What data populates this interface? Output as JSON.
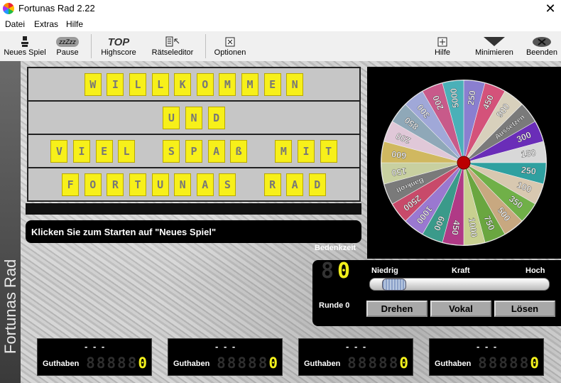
{
  "window": {
    "title": "Fortunas Rad 2.22",
    "close_icon": "close-icon"
  },
  "menu": [
    "Datei",
    "Extras",
    "Hilfe"
  ],
  "toolbar": {
    "neues_spiel": "Neues Spiel",
    "pause": "Pause",
    "pause_glyph": "zzZzz",
    "highscore": "Highscore",
    "highscore_glyph": "TOP",
    "raetseleditor": "Rätseleditor",
    "optionen": "Optionen",
    "hilfe": "Hilfe",
    "minimieren": "Minimieren",
    "beenden": "Beenden"
  },
  "side_banner": "Fortunas Rad",
  "board": {
    "rows": [
      "WILLKOMMEN",
      "UND",
      "VIEL SPAß MIT",
      "FORTUNAS RAD"
    ]
  },
  "message": "Klicken Sie zum Starten auf \"Neues Spiel\"",
  "wheel": {
    "segments": [
      {
        "label": "250",
        "color": "#8a7fd0"
      },
      {
        "label": "450",
        "color": "#d4527a"
      },
      {
        "label": "900",
        "color": "#d8d0bc"
      },
      {
        "label": "Aussetzen",
        "color": "#7a7a7a"
      },
      {
        "label": "300",
        "color": "#6a2db8"
      },
      {
        "label": "150",
        "color": "#d8d8d8"
      },
      {
        "label": "250",
        "color": "#2fa0a0"
      },
      {
        "label": "100",
        "color": "#d8c8b0"
      },
      {
        "label": "350",
        "color": "#70b048"
      },
      {
        "label": "500",
        "color": "#c8a880"
      },
      {
        "label": "750",
        "color": "#6aa640"
      },
      {
        "label": "1000",
        "color": "#c8d090"
      },
      {
        "label": "450",
        "color": "#b03a86"
      },
      {
        "label": "600",
        "color": "#3a9a8a"
      },
      {
        "label": "1000",
        "color": "#9a78d0"
      },
      {
        "label": "2500",
        "color": "#c84a6a"
      },
      {
        "label": "Bankrott",
        "color": "#7a7a7a"
      },
      {
        "label": "150",
        "color": "#c8d0a0"
      },
      {
        "label": "600",
        "color": "#d0b860"
      },
      {
        "label": "200",
        "color": "#e0c8d8"
      },
      {
        "label": "850",
        "color": "#8fa8b8"
      },
      {
        "label": "300",
        "color": "#a0a8d8"
      },
      {
        "label": "200",
        "color": "#c85a8a"
      },
      {
        "label": "5000",
        "color": "#4ab0b8"
      }
    ]
  },
  "controls": {
    "bedenkzeit_label": "Bedenkzeit",
    "timer_value": "0",
    "kraft_min": "Niedrig",
    "kraft_label": "Kraft",
    "kraft_max": "Hoch",
    "kraft_level": 0.08,
    "runde_label": "Runde 0",
    "drehen": "Drehen",
    "vokal": "Vokal",
    "loesen": "Lösen"
  },
  "players": [
    {
      "name": "- - -",
      "label": "Guthaben",
      "value": "0"
    },
    {
      "name": "- - -",
      "label": "Guthaben",
      "value": "0"
    },
    {
      "name": "- - -",
      "label": "Guthaben",
      "value": "0"
    },
    {
      "name": "- - -",
      "label": "Guthaben",
      "value": "0"
    }
  ]
}
